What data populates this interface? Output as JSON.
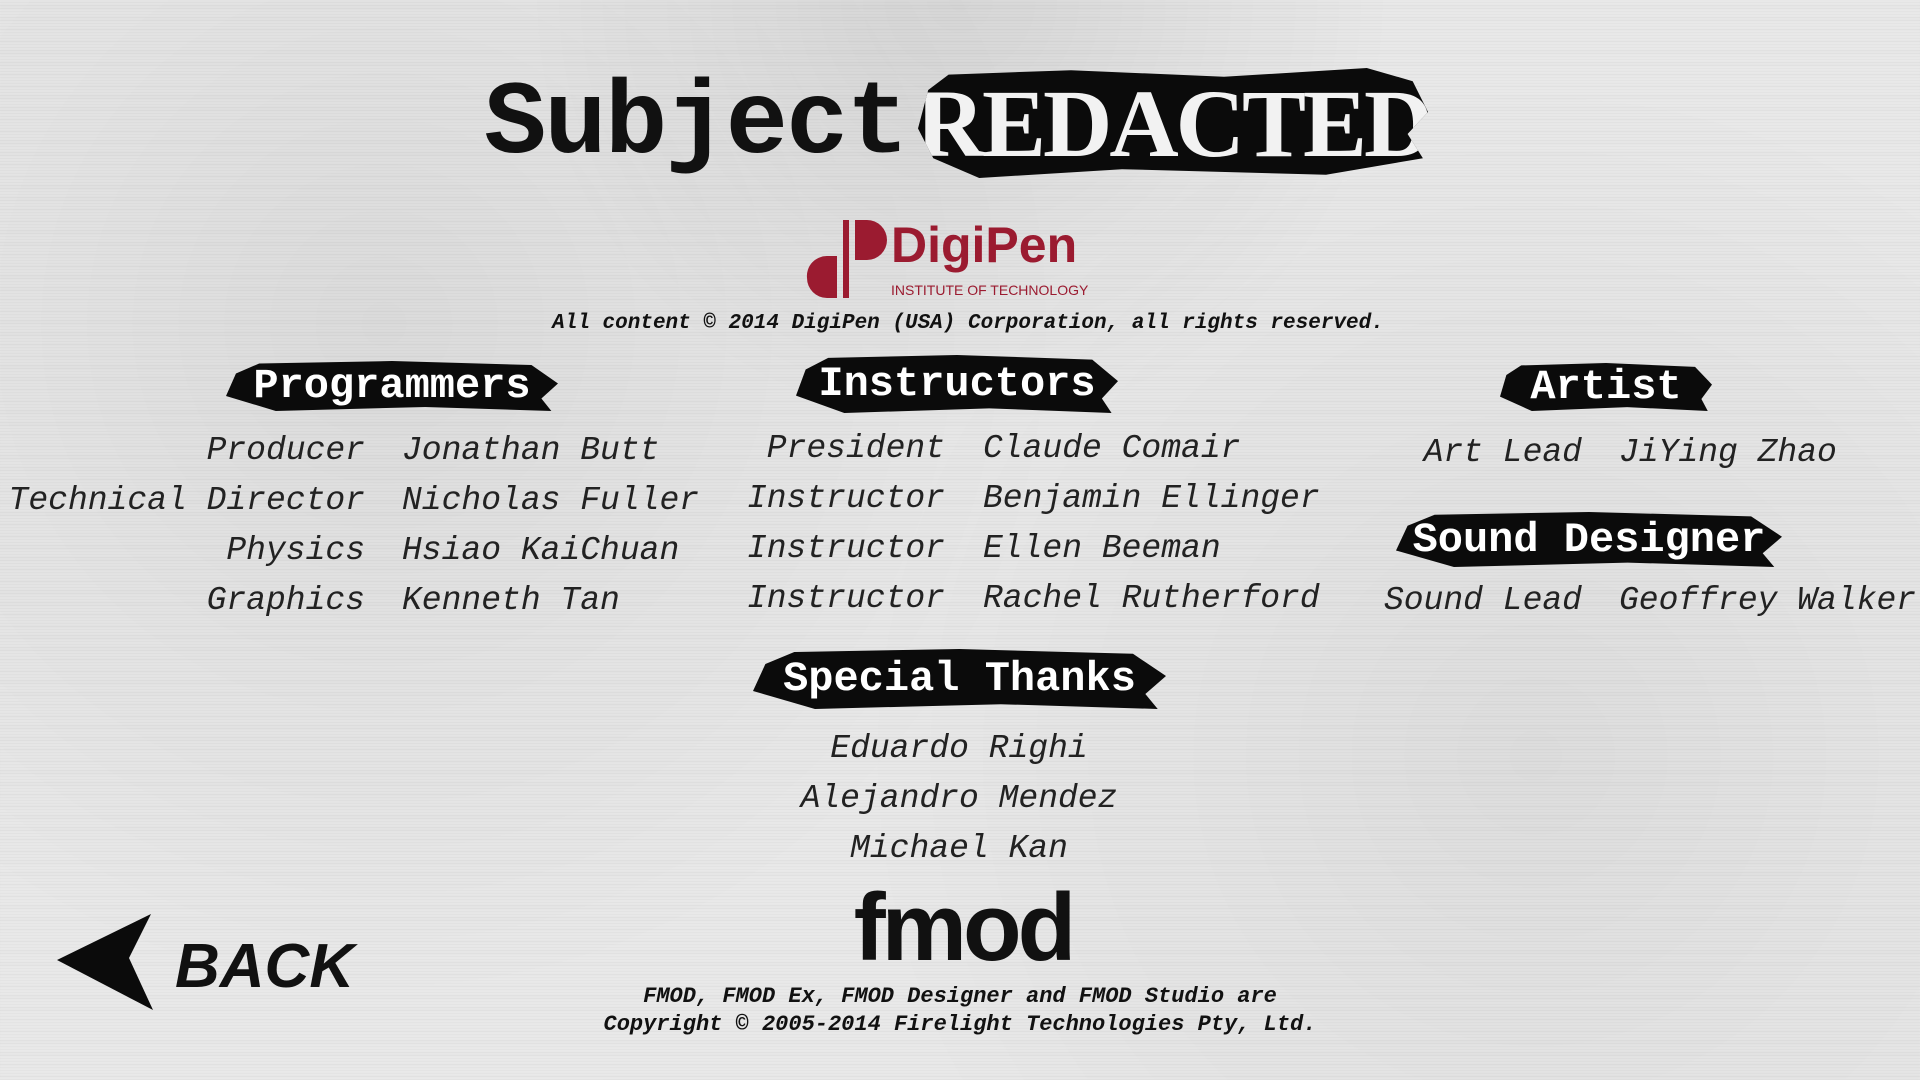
{
  "title": {
    "prefix": "Subject:",
    "redacted": "REDACTED"
  },
  "digipen": {
    "logo_text": "DigiPen",
    "logo_sub": "INSTITUTE OF TECHNOLOGY",
    "brand_color": "#9b1b30",
    "copyright": "All content © 2014 DigiPen (USA) Corporation, all rights reserved."
  },
  "programmers": {
    "heading": "Programmers",
    "rows": [
      {
        "role": "Producer",
        "name": "Jonathan Butt"
      },
      {
        "role": "Technical Director",
        "name": "Nicholas Fuller"
      },
      {
        "role": "Physics",
        "name": "Hsiao KaiChuan"
      },
      {
        "role": "Graphics",
        "name": "Kenneth Tan"
      }
    ]
  },
  "instructors": {
    "heading": "Instructors",
    "rows": [
      {
        "role": "President",
        "name": "Claude Comair"
      },
      {
        "role": "Instructor",
        "name": "Benjamin Ellinger"
      },
      {
        "role": "Instructor",
        "name": "Ellen Beeman"
      },
      {
        "role": "Instructor",
        "name": "Rachel Rutherford"
      }
    ]
  },
  "artist": {
    "heading": "Artist",
    "rows": [
      {
        "role": "Art Lead",
        "name": "JiYing Zhao"
      }
    ]
  },
  "sound": {
    "heading": "Sound Designer",
    "rows": [
      {
        "role": "Sound Lead",
        "name": "Geoffrey Walker"
      }
    ]
  },
  "special_thanks": {
    "heading": "Special Thanks",
    "names": [
      "Eduardo Righi",
      "Alejandro Mendez",
      "Michael Kan"
    ]
  },
  "fmod": {
    "logo_text": "fmod",
    "line1": "FMOD, FMOD Ex, FMOD Designer and FMOD Studio are",
    "line2": "Copyright © 2005-2014 Firelight Technologies Pty, Ltd."
  },
  "nav": {
    "back_label": "BACK",
    "back_icon": "arrow-left-icon"
  }
}
